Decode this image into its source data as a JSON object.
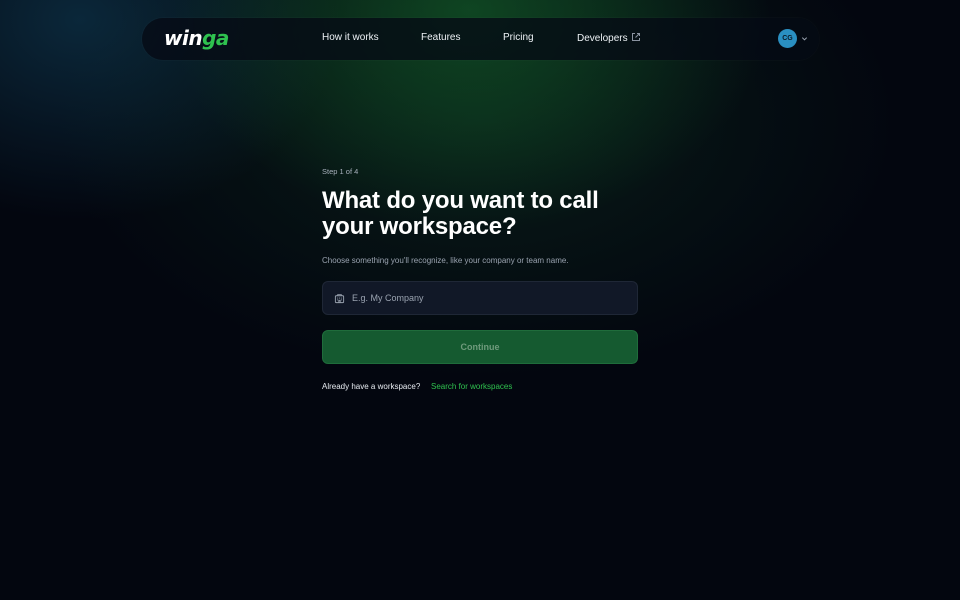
{
  "nav": {
    "logo_main": "win",
    "logo_accent": "ga",
    "links": [
      "How it works",
      "Features",
      "Pricing",
      "Developers"
    ],
    "developers_icon": "external-link-icon",
    "avatar_initials": "CG",
    "avatar_menu_icon": "chevron-down-icon"
  },
  "onboarding": {
    "step": "Step 1 of 4",
    "title": "What do you want to call your workspace?",
    "subtitle": "Choose something you'll recognize, like your company or team name.",
    "input_icon": "building-icon",
    "input_value": "",
    "input_placeholder": "E.g. My Company",
    "continue_label": "Continue",
    "already_text": "Already have a workspace?",
    "search_link": "Search for workspaces"
  },
  "colors": {
    "background": "#03060f",
    "accent_green": "#2fc24f",
    "button_green": "#155a30",
    "avatar_blue": "#2a8fc1"
  }
}
